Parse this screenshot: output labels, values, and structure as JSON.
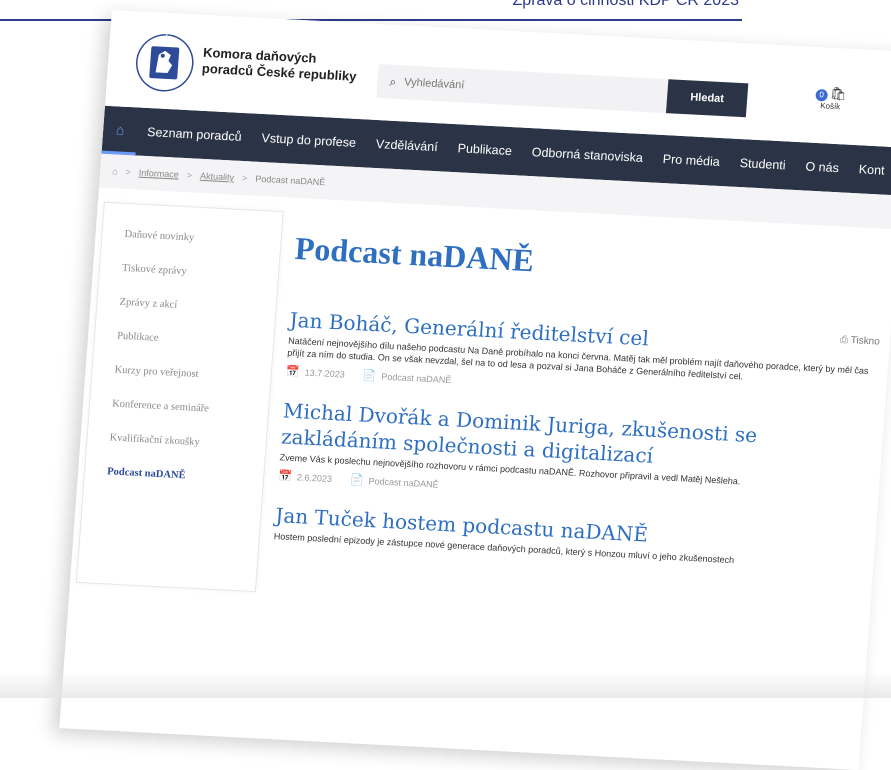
{
  "doc_header": {
    "title": "Zpráva o činnosti KDP ČR 2023"
  },
  "site": {
    "logo_text": "KOMORA DAŇOVÝCH PORADCŮ ČR",
    "brand_line1": "Komora daňových",
    "brand_line2": "poradců České republiky",
    "search_placeholder": "Vyhledávání",
    "search_button": "Hledat",
    "cart_count": "0",
    "cart_label": "Košík"
  },
  "nav": {
    "items": [
      "Seznam poradců",
      "Vstup do profese",
      "Vzdělávání",
      "Publikace",
      "Odborná stanoviska",
      "Pro média",
      "Studenti",
      "O nás",
      "Kont"
    ]
  },
  "breadcrumb": {
    "items": [
      "Informace",
      "Aktuality",
      "Podcast naDANĚ"
    ]
  },
  "sidebar": {
    "items": [
      "Daňové novinky",
      "Tiskové zprávy",
      "Zprávy z akcí",
      "Publikace",
      "Kurzy pro veřejnost",
      "Konference a semináře",
      "Kvalifikační zkoušky",
      "Podcast naDANĚ"
    ],
    "active": "Podcast naDANĚ"
  },
  "main": {
    "title": "Podcast naDANĚ",
    "print_label": "Tiskno",
    "articles": [
      {
        "title": "Jan Boháč, Generální ředitelství cel",
        "text": "Natáčení nejnovějšího dílu našeho podcastu Na Daně probíhalo na konci června. Matěj tak měl problém najít daňového poradce, který by měl čas přijít za ním do studia. On se však nevzdal, šel na to od lesa a pozval si Jana Boháče z Generálního ředitelství cel.",
        "date": "13.7.2023",
        "category": "Podcast naDANĚ"
      },
      {
        "title": "Michal Dvořák a Dominik Juriga, zkušenosti se zakládáním společnosti a digitalizací",
        "text": "Zveme Vás k poslechu nejnovějšího rozhovoru v rámci podcastu naDANĚ. Rozhovor připravil a vedl Matěj Nešleha.",
        "date": "2.6.2023",
        "category": "Podcast naDANĚ"
      },
      {
        "title": "Jan Tuček hostem podcastu naDANĚ",
        "text": "Hostem poslední epizody je zástupce nové generace daňových poradců, který s Honzou mluví o jeho zkušenostech",
        "date": "",
        "category": ""
      }
    ]
  },
  "colors": {
    "navy": "#2b3446",
    "accent_blue": "#2e6fc0",
    "header_line": "#2e3a8c"
  }
}
